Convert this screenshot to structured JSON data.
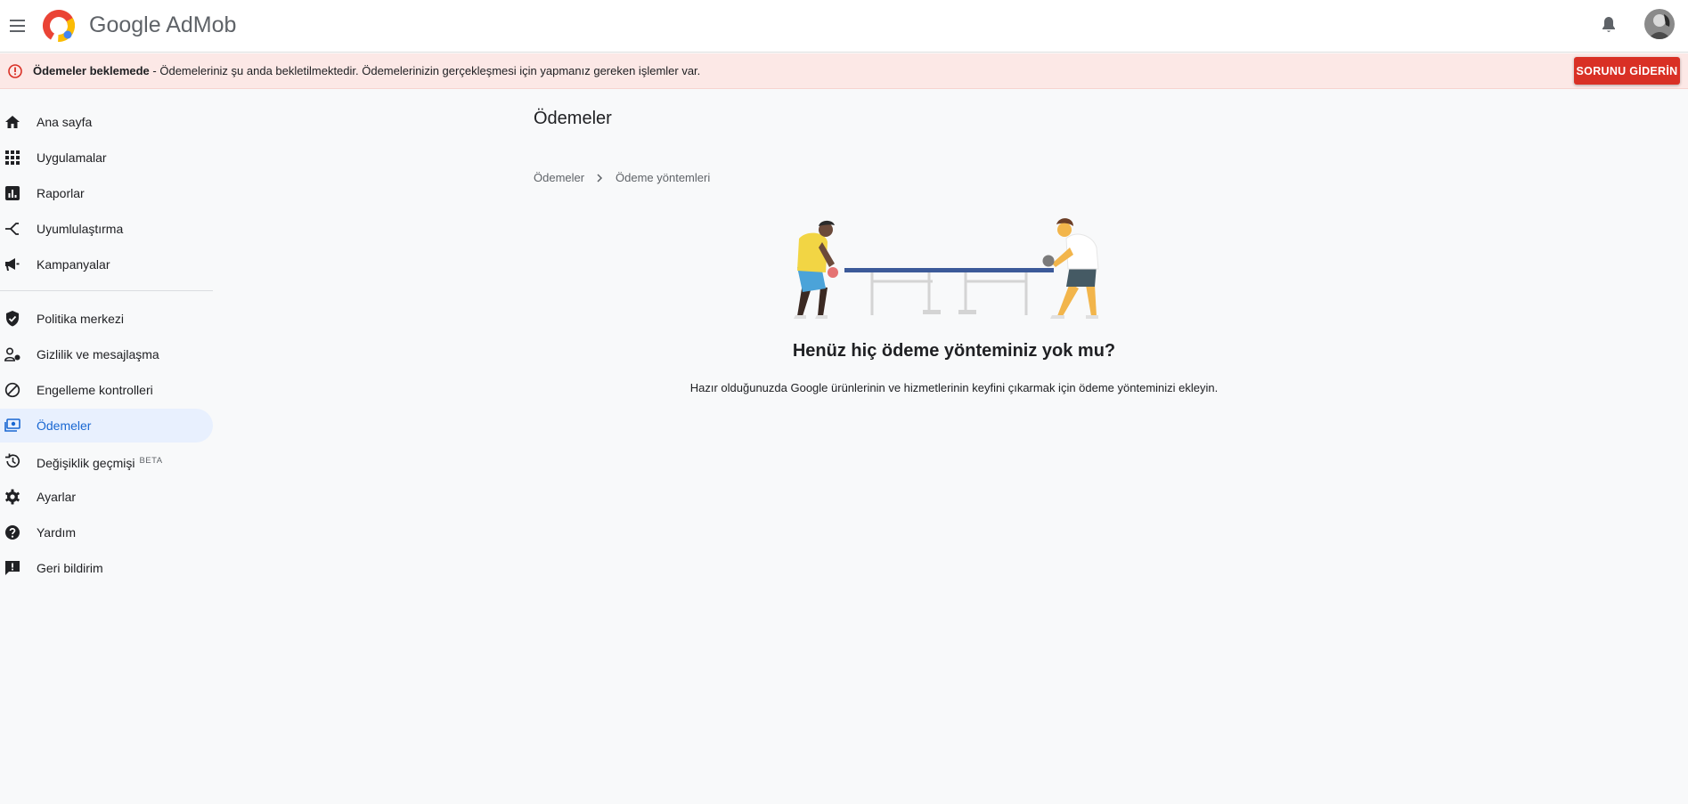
{
  "header": {
    "brand_google": "Google",
    "brand_product": "AdMob"
  },
  "alert": {
    "title": "Ödemeler beklemede",
    "message": " - Ödemeleriniz şu anda bekletilmektedir. Ödemelerinizin gerçekleşmesi için yapmanız gereken işlemler var.",
    "action_label": "SORUNU GİDERİN"
  },
  "sidebar": {
    "items": [
      {
        "label": "Ana sayfa",
        "icon": "home-icon"
      },
      {
        "label": "Uygulamalar",
        "icon": "apps-grid-icon"
      },
      {
        "label": "Raporlar",
        "icon": "bar-chart-icon"
      },
      {
        "label": "Uyumlulaştırma",
        "icon": "mediation-icon"
      },
      {
        "label": "Kampanyalar",
        "icon": "megaphone-icon"
      },
      {
        "label": "Politika merkezi",
        "icon": "shield-check-icon"
      },
      {
        "label": "Gizlilik ve mesajlaşma",
        "icon": "person-privacy-icon"
      },
      {
        "label": "Engelleme kontrolleri",
        "icon": "block-icon"
      },
      {
        "label": "Ödemeler",
        "icon": "payments-icon",
        "active": true
      },
      {
        "label": "Değişiklik geçmişi",
        "icon": "history-icon",
        "badge": "BETA"
      },
      {
        "label": "Ayarlar",
        "icon": "gear-icon"
      },
      {
        "label": "Yardım",
        "icon": "help-icon"
      },
      {
        "label": "Geri bildirim",
        "icon": "feedback-icon"
      }
    ]
  },
  "main": {
    "title": "Ödemeler",
    "breadcrumb": [
      "Ödemeler",
      "Ödeme yöntemleri"
    ],
    "empty_state": {
      "title": "Henüz hiç ödeme yönteminiz yok mu?",
      "description": "Hazır olduğunuzda Google ürünlerinin ve hizmetlerinin keyfini çıkarmak için ödeme yönteminizi ekleyin."
    }
  },
  "colors": {
    "accent": "#1967d2",
    "alert_bg": "#fce8e6",
    "alert_button": "#d93025",
    "active_nav_bg": "#e8f0fe",
    "table_blue": "#3c5a99"
  }
}
